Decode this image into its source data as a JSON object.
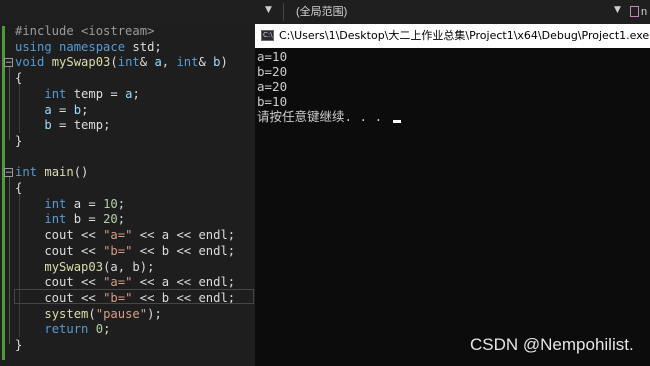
{
  "toolbar": {
    "scope_label": "(全局范围)",
    "right_stub": "n"
  },
  "code_lines": [
    {
      "parts": [
        {
          "t": "#include <iostream>",
          "c": "gray"
        }
      ]
    },
    {
      "parts": [
        {
          "t": "using namespace ",
          "c": "kw"
        },
        {
          "t": "std;",
          "c": "txt"
        }
      ]
    },
    {
      "parts": [
        {
          "t": "void ",
          "c": "kw"
        },
        {
          "t": "mySwap03",
          "c": "fn"
        },
        {
          "t": "(",
          "c": "txt"
        },
        {
          "t": "int",
          "c": "kw"
        },
        {
          "t": "& ",
          "c": "txt"
        },
        {
          "t": "a",
          "c": "par"
        },
        {
          "t": ", ",
          "c": "txt"
        },
        {
          "t": "int",
          "c": "kw"
        },
        {
          "t": "& ",
          "c": "txt"
        },
        {
          "t": "b",
          "c": "par"
        },
        {
          "t": ")",
          "c": "txt"
        }
      ]
    },
    {
      "parts": [
        {
          "t": "{",
          "c": "txt"
        }
      ]
    },
    {
      "parts": [
        {
          "t": "    ",
          "c": "txt"
        },
        {
          "t": "int ",
          "c": "kw"
        },
        {
          "t": "temp = ",
          "c": "txt"
        },
        {
          "t": "a",
          "c": "par"
        },
        {
          "t": ";",
          "c": "txt"
        }
      ]
    },
    {
      "parts": [
        {
          "t": "    ",
          "c": "txt"
        },
        {
          "t": "a",
          "c": "par"
        },
        {
          "t": " = ",
          "c": "txt"
        },
        {
          "t": "b",
          "c": "par"
        },
        {
          "t": ";",
          "c": "txt"
        }
      ]
    },
    {
      "parts": [
        {
          "t": "    ",
          "c": "txt"
        },
        {
          "t": "b",
          "c": "par"
        },
        {
          "t": " = temp;",
          "c": "txt"
        }
      ]
    },
    {
      "parts": [
        {
          "t": "}",
          "c": "txt"
        }
      ]
    },
    {
      "parts": []
    },
    {
      "parts": [
        {
          "t": "int ",
          "c": "kw"
        },
        {
          "t": "main",
          "c": "fn"
        },
        {
          "t": "()",
          "c": "txt"
        }
      ]
    },
    {
      "parts": [
        {
          "t": "{",
          "c": "txt"
        }
      ]
    },
    {
      "parts": [
        {
          "t": "    ",
          "c": "txt"
        },
        {
          "t": "int ",
          "c": "kw"
        },
        {
          "t": "a = ",
          "c": "txt"
        },
        {
          "t": "10",
          "c": "num"
        },
        {
          "t": ";",
          "c": "txt"
        }
      ]
    },
    {
      "parts": [
        {
          "t": "    ",
          "c": "txt"
        },
        {
          "t": "int ",
          "c": "kw"
        },
        {
          "t": "b = ",
          "c": "txt"
        },
        {
          "t": "20",
          "c": "num"
        },
        {
          "t": ";",
          "c": "txt"
        }
      ]
    },
    {
      "parts": [
        {
          "t": "    cout << ",
          "c": "txt"
        },
        {
          "t": "\"a=\"",
          "c": "str"
        },
        {
          "t": " << a << endl;",
          "c": "txt"
        }
      ]
    },
    {
      "parts": [
        {
          "t": "    cout << ",
          "c": "txt"
        },
        {
          "t": "\"b=\"",
          "c": "str"
        },
        {
          "t": " << b << endl;",
          "c": "txt"
        }
      ]
    },
    {
      "parts": [
        {
          "t": "    ",
          "c": "txt"
        },
        {
          "t": "mySwap03",
          "c": "fn"
        },
        {
          "t": "(a, b);",
          "c": "txt"
        }
      ]
    },
    {
      "parts": [
        {
          "t": "    cout << ",
          "c": "txt"
        },
        {
          "t": "\"a=\"",
          "c": "str"
        },
        {
          "t": " << a << endl;",
          "c": "txt"
        }
      ]
    },
    {
      "parts": [
        {
          "t": "    cout << ",
          "c": "txt"
        },
        {
          "t": "\"b=\"",
          "c": "str"
        },
        {
          "t": " << b << endl;",
          "c": "txt"
        }
      ]
    },
    {
      "parts": [
        {
          "t": "    ",
          "c": "txt"
        },
        {
          "t": "system",
          "c": "fn"
        },
        {
          "t": "(",
          "c": "txt"
        },
        {
          "t": "\"pause\"",
          "c": "str"
        },
        {
          "t": ");",
          "c": "txt"
        }
      ]
    },
    {
      "parts": [
        {
          "t": "    ",
          "c": "txt"
        },
        {
          "t": "return ",
          "c": "kw"
        },
        {
          "t": "0",
          "c": "num"
        },
        {
          "t": ";",
          "c": "txt"
        }
      ]
    },
    {
      "parts": [
        {
          "t": "}",
          "c": "txt"
        }
      ]
    }
  ],
  "console": {
    "title": "C:\\Users\\1\\Desktop\\大二上作业总集\\Project1\\x64\\Debug\\Project1.exe",
    "icon_text": "C:\\",
    "output": [
      "a=10",
      "b=20",
      "a=20",
      "b=10",
      "请按任意键继续. . . "
    ]
  },
  "watermark": "CSDN @Nempohilist."
}
